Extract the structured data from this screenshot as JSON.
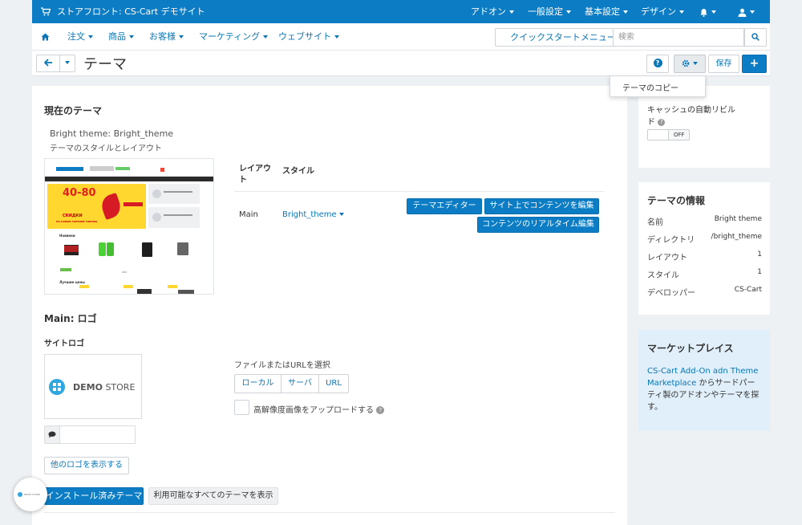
{
  "topbar": {
    "store_title": "ストアフロント: CS-Cart デモサイト",
    "menus": [
      "アドオン",
      "一般設定",
      "基本設定",
      "デザイン"
    ],
    "bell_icon": "bell-icon",
    "user_icon": "user-icon"
  },
  "nav": {
    "items": [
      "注文",
      "商品",
      "お客様",
      "マーケティング",
      "ウェブサイト"
    ],
    "quick_menu": "クイックスタートメニュー",
    "search_placeholder": "検索"
  },
  "header": {
    "title": "テーマ",
    "help": "?",
    "save": "保存",
    "add": "+"
  },
  "dropdown": {
    "copy_theme": "テーマのコピー"
  },
  "current": {
    "section_title": "現在のテーマ",
    "theme_name": "Bright theme: Bright_theme",
    "theme_sub": "テーマのスタイルとレイアウト",
    "col_layout": "レイアウト",
    "col_style": "スタイル",
    "layout_value": "Main",
    "style_value": "Bright_theme",
    "btn_editor": "テーマエディター",
    "btn_edit_site": "サイト上でコンテンツを編集",
    "btn_realtime": "コンテンツのリアルタイム編集"
  },
  "preview": {
    "promo_number": "40-80",
    "promo_text": "СКИДКИ",
    "promo_sub": "НА САМЫЕ ГОРЯЧИЕ ТОВАРЫ",
    "section_label": "Новинки",
    "section_label2": "Лучшие цены"
  },
  "logo": {
    "section_title": "Main: ロゴ",
    "site_logo_label": "サイトロゴ",
    "logo_text_bold": "DEMO",
    "logo_text_light": " STORE",
    "file_label": "ファイルまたはURLを選択",
    "src_local": "ローカル",
    "src_server": "サーバ",
    "src_url": "URL",
    "hidpi_label": "高解像度画像をアップロードする",
    "show_other": "他のロゴを表示する"
  },
  "tabs": {
    "installed": "インストール済みテーマ",
    "all": "利用可能なすべてのテーマを表示"
  },
  "sidebar": {
    "cache_label": "キャッシュの自動リビルド",
    "toggle_off": "OFF",
    "info_title": "テーマの情報",
    "info_rows": [
      {
        "key": "名前",
        "value": "Bright theme",
        "link": false
      },
      {
        "key": "ディレクトリ",
        "value": "/bright_theme",
        "link": true
      },
      {
        "key": "レイアウト",
        "value": "1",
        "link": true
      },
      {
        "key": "スタイル",
        "value": "1",
        "link": true
      },
      {
        "key": "デベロッパー",
        "value": "CS-Cart",
        "link": false
      }
    ],
    "market_title": "マーケットプレイス",
    "market_link": "CS-Cart Add-On adn Theme Marketplace",
    "market_text": " からサードパーティ製のアドオンやテーマを探す。"
  },
  "chat_badge": "DEMO STORE",
  "colors": {
    "primary": "#0c7dc4",
    "link": "#0a76b6",
    "market_bg": "#e0eff9"
  }
}
